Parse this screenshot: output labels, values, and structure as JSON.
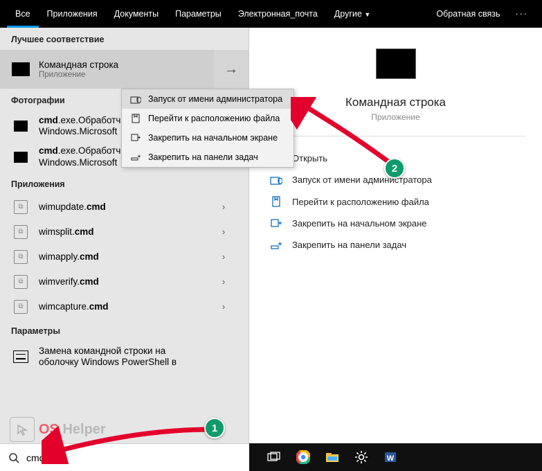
{
  "topbar": {
    "tabs": [
      "Все",
      "Приложения",
      "Документы",
      "Параметры",
      "Электронная_почта",
      "Другие"
    ],
    "feedback": "Обратная связь",
    "more": "···"
  },
  "sections": {
    "best": "Лучшее соответствие",
    "photos": "Фотографии",
    "apps": "Приложения",
    "settings": "Параметры"
  },
  "best_match": {
    "title": "Командная строка",
    "sub": "Приложение"
  },
  "photos": [
    {
      "pre": "cmd",
      "post": ".exe.Обработчи",
      "line2": "Windows.Microsoft"
    },
    {
      "pre": "cmd",
      "post": ".exe.Обработчик команд",
      "line2": "Windows.Microsoft"
    }
  ],
  "apps": [
    {
      "pre": "wimupdate.",
      "bold": "cmd"
    },
    {
      "pre": "wimsplit.",
      "bold": "cmd"
    },
    {
      "pre": "wimapply.",
      "bold": "cmd"
    },
    {
      "pre": "wimverify.",
      "bold": "cmd"
    },
    {
      "pre": "wimcapture.",
      "bold": "cmd"
    }
  ],
  "settings_item": {
    "line1": "Замена командной строки на",
    "line2": "оболочку Windows PowerShell в"
  },
  "context_menu": [
    "Запуск от имени администратора",
    "Перейти к расположению файла",
    "Закрепить на начальном экране",
    "Закрепить на панели задач"
  ],
  "preview": {
    "title": "Командная строка",
    "sub": "Приложение",
    "actions": [
      "Открыть",
      "Запуск от имени администратора",
      "Перейти к расположению файла",
      "Закрепить на начальном экране",
      "Закрепить на панели задач"
    ]
  },
  "search": {
    "value": "cmd"
  },
  "annotations": {
    "badge1": "1",
    "badge2": "2"
  },
  "watermark": {
    "text_a": "OS",
    "text_b": " Helper"
  }
}
